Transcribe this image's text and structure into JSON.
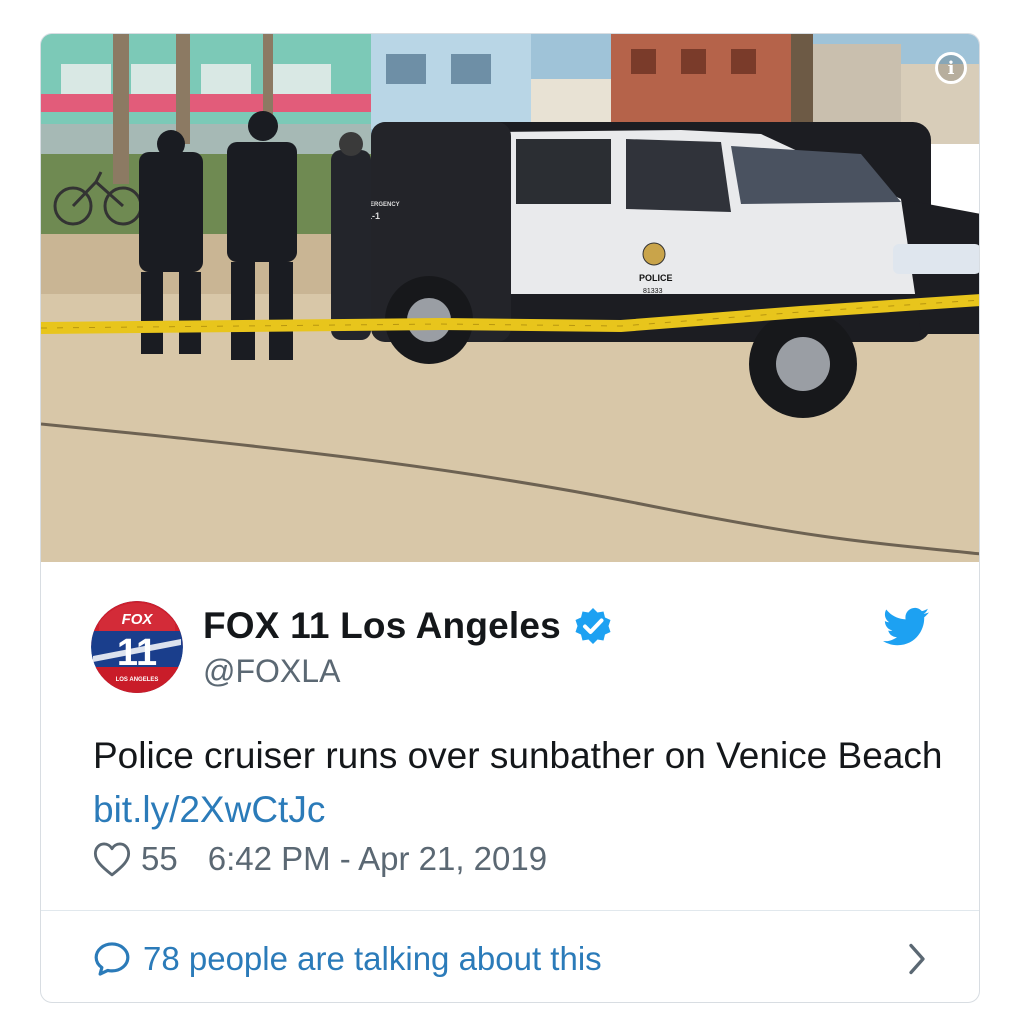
{
  "tweet": {
    "author_name": "FOX 11 Los Angeles",
    "handle": "@FOXLA",
    "text": "Police cruiser runs over sunbather on Venice Beach",
    "text_main": "Police cruiser runs over sunbather on Venice Beach ",
    "link": "bit.ly/2XwCtJc",
    "likes": "55",
    "timestamp": "6:42 PM - Apr 21, 2019",
    "talking": "78 people are talking about this"
  },
  "avatar": {
    "brand_top": "FOX",
    "brand_number": "11",
    "brand_bottom": "LOS ANGELES"
  },
  "media": {
    "truck_text_police": "POLICE",
    "truck_text_unit": "81333",
    "truck_text_emergency": "EMERGENCY",
    "truck_text_911": "9-1-1"
  },
  "icons": {
    "info": "info-icon",
    "verified": "verified-badge-icon",
    "bird": "twitter-bird-icon",
    "heart": "heart-icon",
    "comment": "comment-bubble-icon",
    "chevron": "chevron-right-icon"
  },
  "colors": {
    "link": "#2b7bb9",
    "verified": "#1da1f2",
    "twitter": "#1da1f2",
    "muted": "#5b6873",
    "caution_tape": "#e8c51c"
  }
}
